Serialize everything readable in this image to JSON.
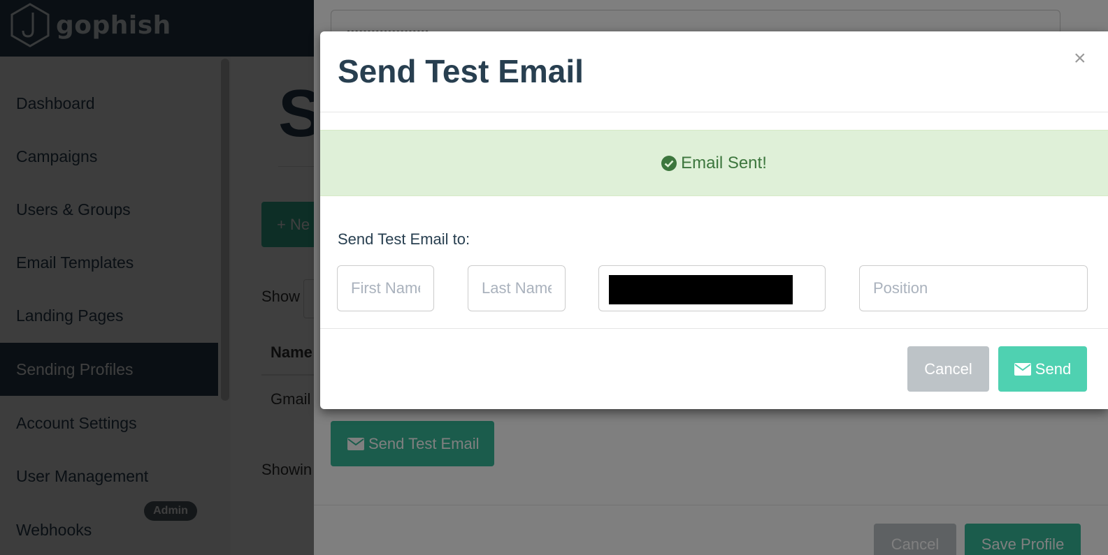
{
  "app": {
    "brand": "gophish"
  },
  "sidebar": {
    "items": [
      {
        "label": "Dashboard"
      },
      {
        "label": "Campaigns"
      },
      {
        "label": "Users & Groups"
      },
      {
        "label": "Email Templates"
      },
      {
        "label": "Landing Pages"
      },
      {
        "label": "Sending Profiles",
        "active": true
      },
      {
        "label": "Account Settings"
      },
      {
        "label": "User Management"
      },
      {
        "label": "Webhooks"
      }
    ],
    "admin_badge": "Admin"
  },
  "background": {
    "page_title_partial": "S",
    "new_button_partial": "+ Ne",
    "show_label": "Show",
    "table_header_partial": "Name",
    "row_partial": "Gmail",
    "showing_partial": "Showin"
  },
  "profile_modal": {
    "password_mask": "••••••••••••••••••••",
    "send_test_email_label": "Send Test Email",
    "cancel_label": "Cancel",
    "save_label": "Save Profile"
  },
  "test_email_modal": {
    "title": "Send Test Email",
    "close_symbol": "×",
    "alert_text": "Email Sent!",
    "send_to_label": "Send Test Email to:",
    "fields": {
      "first_name_placeholder": "First Name",
      "last_name_placeholder": "Last Name",
      "position_placeholder": "Position"
    },
    "cancel_label": "Cancel",
    "send_label": "Send"
  },
  "colors": {
    "navbar": "#283f50",
    "accent": "#37b899",
    "send_button": "#4fd1b1",
    "alert_bg": "#dff0d8",
    "alert_text": "#3c763d"
  }
}
